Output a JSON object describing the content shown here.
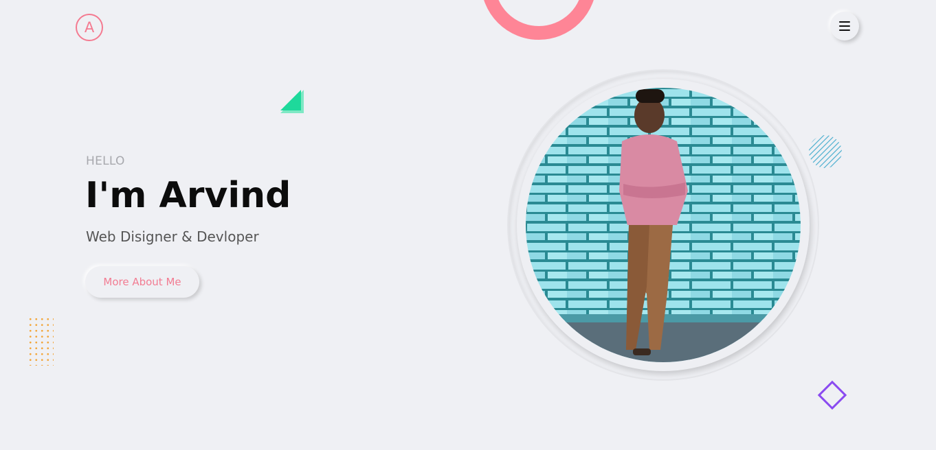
{
  "header": {
    "logo_letter": "A",
    "menu_icon": "hamburger-icon"
  },
  "hero": {
    "greeting": "HELLO",
    "title": "I'm Arvind",
    "subtitle": "Web Disigner & Devloper",
    "cta_label": "More About Me"
  },
  "colors": {
    "background": "#eff0f4",
    "accent_pink": "#fe8596",
    "accent_green": "#1ed99b",
    "accent_orange": "#f3a63c",
    "accent_purple": "#8a4af0",
    "accent_blue": "#4fb0d0"
  },
  "decorations": [
    "pink-ring-shape",
    "green-triangle-shape",
    "orange-dot-grid",
    "blue-hatched-circle",
    "purple-diamond-shape"
  ]
}
